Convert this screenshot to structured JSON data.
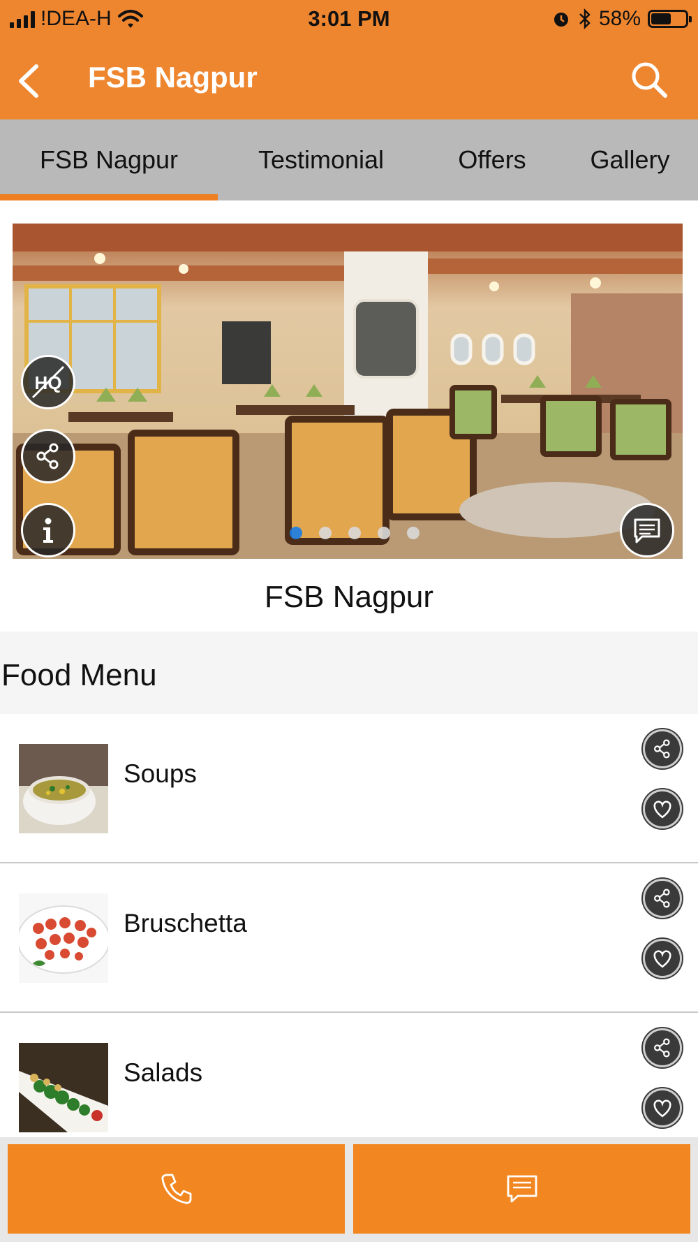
{
  "status_bar": {
    "carrier": "!DEA-H",
    "time": "3:01 PM",
    "battery_text": "58%",
    "battery_level": 0.58
  },
  "nav": {
    "title": "FSB Nagpur"
  },
  "tabs": [
    {
      "label": "FSB Nagpur",
      "active": true
    },
    {
      "label": "Testimonial",
      "active": false
    },
    {
      "label": "Offers",
      "active": false
    },
    {
      "label": "Gallery",
      "active": false
    }
  ],
  "hero": {
    "hq_badge": "HQ",
    "slide_count": 5,
    "active_slide": 1
  },
  "place_title": "FSB Nagpur",
  "food_menu": {
    "title": "Food Menu",
    "items": [
      {
        "label": "Soups"
      },
      {
        "label": "Bruschetta"
      },
      {
        "label": "Salads"
      }
    ]
  },
  "colors": {
    "brand_orange": "#ee8630",
    "tab_bar": "#b9b9b9",
    "active_dot": "#1a7de6"
  },
  "icons": {
    "back": "chevron-left-icon",
    "search": "search-icon",
    "share": "share-icon",
    "info": "info-icon",
    "chat": "chat-icon",
    "heart": "heart-icon",
    "phone": "phone-icon",
    "message": "message-icon"
  }
}
